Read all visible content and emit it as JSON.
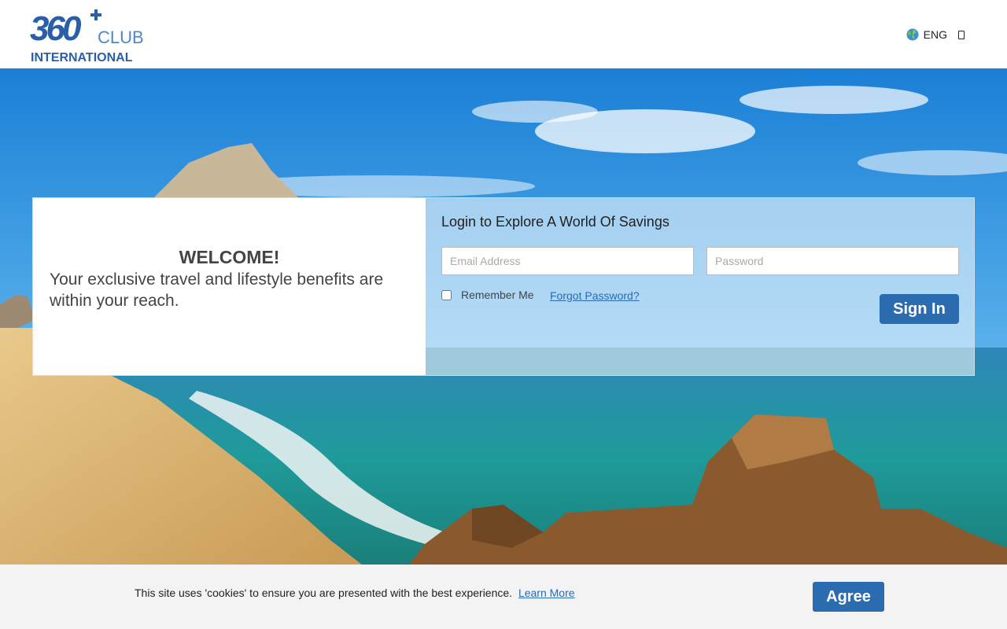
{
  "header": {
    "logo": {
      "number": "360",
      "club": "CLUB",
      "international": "INTERNATIONAL"
    },
    "language": {
      "label": "ENG",
      "icon": "globe-icon",
      "caret_icon": "chevron-down-icon"
    }
  },
  "welcome": {
    "heading": "WELCOME!",
    "text": "Your exclusive travel and lifestyle benefits are within your reach."
  },
  "login": {
    "heading": "Login to Explore A World Of Savings",
    "email_placeholder": "Email Address",
    "password_placeholder": "Password",
    "remember_label": "Remember Me",
    "forgot_label": "Forgot Password?",
    "signin_label": "Sign In"
  },
  "cookie": {
    "text": "This site uses 'cookies' to ensure you are presented with the best experience.",
    "link": "Learn More",
    "agree_label": "Agree"
  },
  "colors": {
    "brand_blue": "#2b6cb0",
    "logo_blue": "#2a5fa8",
    "cookie_bg": "#f3f3f3"
  }
}
